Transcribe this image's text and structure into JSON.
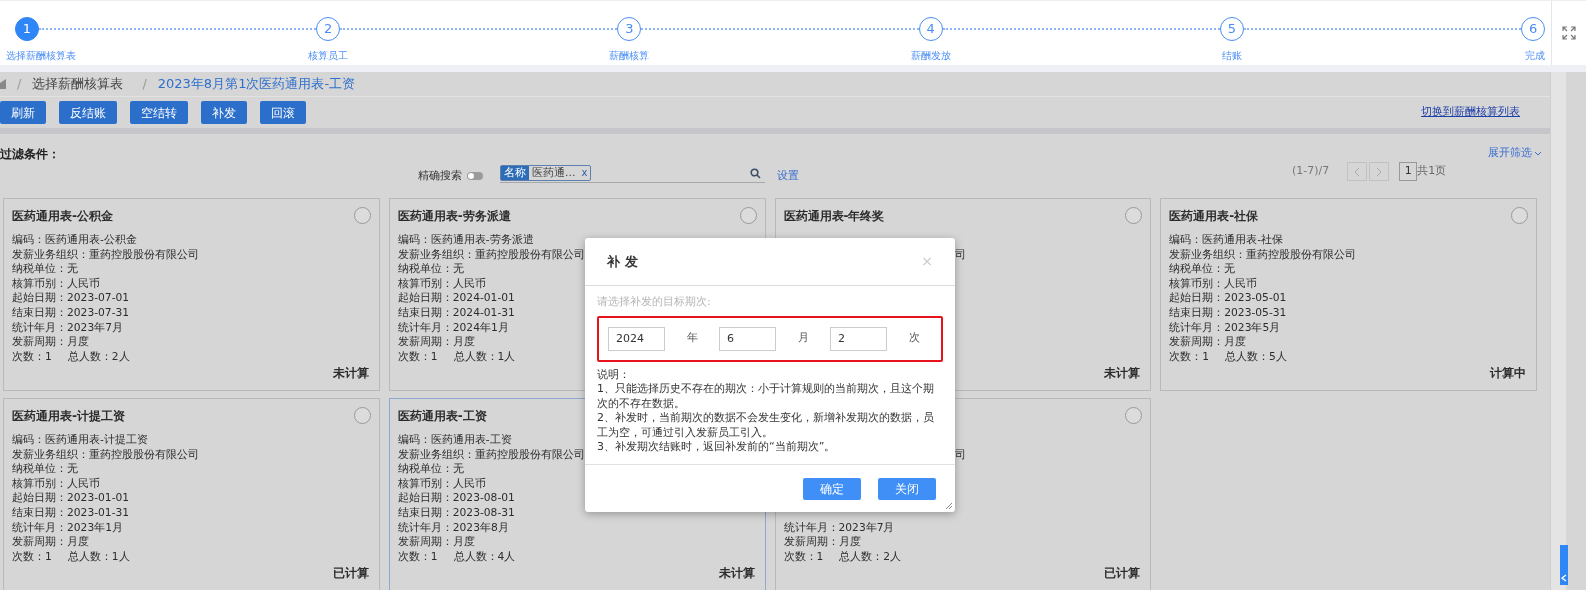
{
  "steps": [
    {
      "number": "1",
      "label": "选择薪酬核算表",
      "selected": true
    },
    {
      "number": "2",
      "label": "核算员工",
      "selected": false
    },
    {
      "number": "3",
      "label": "薪酬核算",
      "selected": false
    },
    {
      "number": "4",
      "label": "薪酬发放",
      "selected": false
    },
    {
      "number": "5",
      "label": "结账",
      "selected": false
    },
    {
      "number": "6",
      "label": "完成",
      "selected": false
    }
  ],
  "breadcrumb": [
    {
      "label": "选择薪酬核算表",
      "current": false
    },
    {
      "label": "2023年8月第1次医药通用表-工资",
      "current": true
    }
  ],
  "breadcrumb_separator": "/",
  "toolbar": {
    "buttons": [
      "刷新",
      "反结账",
      "空结转",
      "补发",
      "回滚"
    ],
    "link": "切换到薪酬核算列表"
  },
  "filter": {
    "title": "过滤条件：",
    "expand": "展开筛选",
    "exact_search": {
      "label": "精确搜索",
      "on": false
    },
    "tag": {
      "name": "名称",
      "value": "医药通...",
      "remove": "x"
    },
    "settings": "设置"
  },
  "pagination": {
    "range": "(1-7)/7",
    "page": "1",
    "total": "共1页"
  },
  "cards": [
    {
      "title": "医药通用表-公积金",
      "selected": false,
      "status": "未计算",
      "lines": [
        {
          "kind": "text",
          "text": "编码：医药通用表-公积金"
        },
        {
          "kind": "text",
          "text": "发薪业务组织：重药控股股份有限公司"
        },
        {
          "kind": "text",
          "text": "纳税单位：无"
        },
        {
          "kind": "text",
          "text": "核算币别：人民币"
        },
        {
          "kind": "text",
          "text": "起始日期：2023-07-01"
        },
        {
          "kind": "text",
          "text": "结束日期：2023-07-31"
        },
        {
          "kind": "text",
          "text": "统计年月：2023年7月"
        },
        {
          "kind": "text",
          "text": "发薪周期：月度"
        }
      ],
      "counts": [
        "次数：1",
        "总人数：2人"
      ]
    },
    {
      "title": "医药通用表-劳务派遣",
      "selected": false,
      "lines": [
        {
          "kind": "text",
          "text": "编码：医药通用表-劳务派遣"
        },
        {
          "kind": "text",
          "text": "发薪业务组织：重药控股股份有限公司"
        },
        {
          "kind": "text",
          "text": "纳税单位：无"
        },
        {
          "kind": "text",
          "text": "核算币别：人民币"
        },
        {
          "kind": "text",
          "text": "起始日期：2024-01-01"
        },
        {
          "kind": "text",
          "text": "结束日期：2024-01-31"
        },
        {
          "kind": "text",
          "text": "统计年月：2024年1月"
        },
        {
          "kind": "text",
          "text": "发薪周期：月度"
        }
      ],
      "counts": [
        "次数：1",
        "总人数：1人"
      ]
    },
    {
      "title": "医药通用表-年终奖",
      "selected": false,
      "status": "未计算",
      "lines": [
        {
          "kind": "covered"
        },
        {
          "kind": "tail",
          "text": "司"
        }
      ]
    },
    {
      "title": "医药通用表-社保",
      "selected": false,
      "status": "计算中",
      "lines": [
        {
          "kind": "text",
          "text": "编码：医药通用表-社保"
        },
        {
          "kind": "text",
          "text": "发薪业务组织：重药控股股份有限公司"
        },
        {
          "kind": "text",
          "text": "纳税单位：无"
        },
        {
          "kind": "text",
          "text": "核算币别：人民币"
        },
        {
          "kind": "text",
          "text": "起始日期：2023-05-01"
        },
        {
          "kind": "text",
          "text": "结束日期：2023-05-31"
        },
        {
          "kind": "text",
          "text": "统计年月：2023年5月"
        },
        {
          "kind": "text",
          "text": "发薪周期：月度"
        }
      ],
      "counts": [
        "次数：1",
        "总人数：5人"
      ]
    },
    {
      "title": "医药通用表-计提工资",
      "selected": false,
      "status": "已计算",
      "lines": [
        {
          "kind": "text",
          "text": "编码：医药通用表-计提工资"
        },
        {
          "kind": "text",
          "text": "发薪业务组织：重药控股股份有限公司"
        },
        {
          "kind": "text",
          "text": "纳税单位：无"
        },
        {
          "kind": "text",
          "text": "核算币别：人民币"
        },
        {
          "kind": "text",
          "text": "起始日期：2023-01-01"
        },
        {
          "kind": "text",
          "text": "结束日期：2023-01-31"
        },
        {
          "kind": "text",
          "text": "统计年月：2023年1月"
        },
        {
          "kind": "text",
          "text": "发薪周期：月度"
        }
      ],
      "counts": [
        "次数：1",
        "总人数：1人"
      ]
    },
    {
      "title": "医药通用表-工资",
      "selected": true,
      "status": "未计算",
      "lines": [
        {
          "kind": "text",
          "text": "编码：医药通用表-工资"
        },
        {
          "kind": "text",
          "text": "发薪业务组织：重药控股股份有限公司"
        },
        {
          "kind": "text",
          "text": "纳税单位：无"
        },
        {
          "kind": "text",
          "text": "核算币别：人民币"
        },
        {
          "kind": "text",
          "text": "起始日期：2023-08-01"
        },
        {
          "kind": "text",
          "text": "结束日期：2023-08-31"
        },
        {
          "kind": "text",
          "text": "统计年月：2023年8月"
        },
        {
          "kind": "text",
          "text": "发薪周期：月度"
        }
      ],
      "counts": [
        "次数：1",
        "总人数：4人"
      ]
    },
    {
      "selected": false,
      "status": "已计算",
      "lines": [
        {
          "kind": "covered"
        },
        {
          "kind": "tail",
          "text": "司"
        },
        {
          "kind": "covered"
        },
        {
          "kind": "covered"
        },
        {
          "kind": "covered"
        },
        {
          "kind": "covered"
        },
        {
          "kind": "text",
          "text": "统计年月：2023年7月"
        },
        {
          "kind": "text",
          "text": "发薪周期：月度"
        }
      ],
      "counts": [
        "次数：1",
        "总人数：2人"
      ]
    }
  ],
  "dialog": {
    "title": "补 发",
    "close": "×",
    "prompt": "请选择补发的目标期次:",
    "fields": [
      {
        "value": "2024",
        "unit": "年"
      },
      {
        "value": "6",
        "unit": "月"
      },
      {
        "value": "2",
        "unit": "次"
      }
    ],
    "notes": [
      "说明：",
      "1、只能选择历史不存在的期次：小于计算规则的当前期次，且这个期次的不存在数据。",
      "2、补发时，当前期次的数据不会发生变化，新增补发期次的数据，员工为空，可通过引入发薪员工引入。",
      "3、补发期次结账时，返回补发前的“当前期次”。"
    ],
    "buttons": [
      "确定",
      "关闭"
    ]
  }
}
